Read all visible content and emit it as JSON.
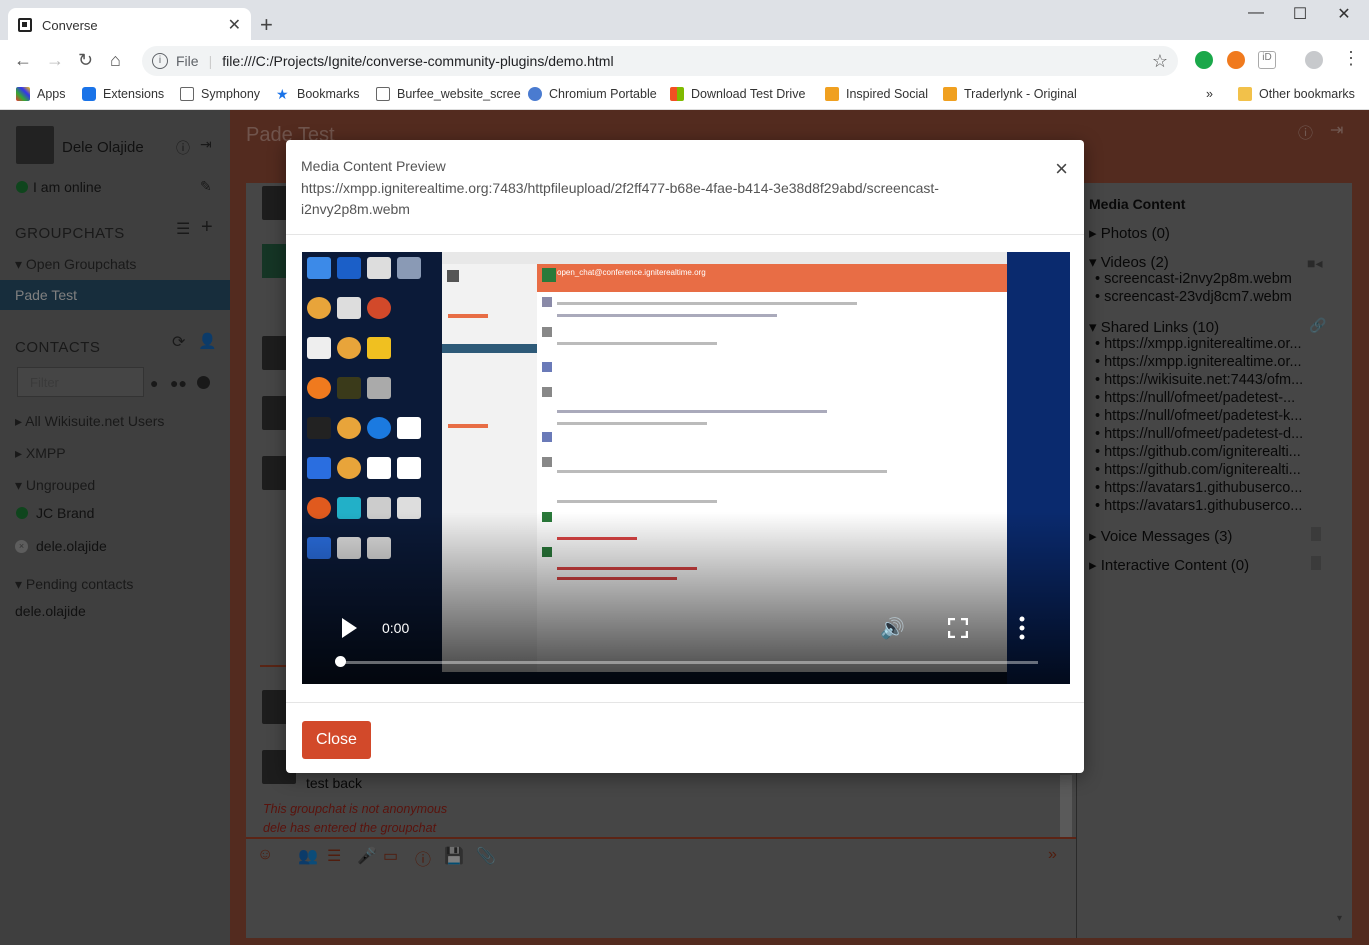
{
  "browser": {
    "tab_title": "Converse",
    "url_scheme_label": "File",
    "url": "file:///C:/Projects/Ignite/converse-community-plugins/demo.html",
    "bookmarks": [
      "Apps",
      "Extensions",
      "Symphony",
      "Bookmarks",
      "Burfee_website_scree",
      "Chromium Portable",
      "Download Test Drive",
      "Inspired Social",
      "Traderlynk - Original"
    ],
    "other_bookmarks": "Other bookmarks",
    "overflow": "»"
  },
  "sidebar": {
    "user_name": "Dele Olajide",
    "status": "I am online",
    "groupchats_heading": "GROUPCHATS",
    "open_groupchats": "Open Groupchats",
    "active_room": "Pade Test",
    "contacts_heading": "CONTACTS",
    "filter_placeholder": "Filter",
    "groups": [
      "All Wikisuite.net Users",
      "XMPP"
    ],
    "ungrouped": "Ungrouped",
    "contacts": [
      "JC Brand",
      "dele.olajide"
    ],
    "pending_heading": "Pending contacts",
    "pending": [
      "dele.olajide"
    ]
  },
  "room": {
    "title": "Pade Test",
    "last_message": "test back",
    "notices": [
      "This groupchat is not anonymous",
      "dele has entered the groupchat"
    ]
  },
  "media_panel": {
    "title": "Media Content",
    "photos": "Photos (0)",
    "videos": "Videos (2)",
    "video_items": [
      "screencast-i2nvy2p8m.webm",
      "screencast-23vdj8cm7.webm"
    ],
    "links": "Shared Links (10)",
    "link_items": [
      "https://xmpp.igniterealtime.or...",
      "https://xmpp.igniterealtime.or...",
      "https://wikisuite.net:7443/ofm...",
      "https://null/ofmeet/padetest-...",
      "https://null/ofmeet/padetest-k...",
      "https://null/ofmeet/padetest-d...",
      "https://github.com/igniterealti...",
      "https://github.com/igniterealti...",
      "https://avatars1.githubuserco...",
      "https://avatars1.githubuserco..."
    ],
    "voice": "Voice Messages (3)",
    "interactive": "Interactive Content (0)"
  },
  "modal": {
    "title": "Media Content Preview",
    "url": "https://xmpp.igniterealtime.org:7483/httpfileupload/2f2ff477-b68e-4fae-b414-3e38d8f29abd/screencast-i2nvy2p8m.webm",
    "close_label": "Close",
    "time": "0:00",
    "progress": 0,
    "inner_room": "open_chat@conference.igniterealtime.org"
  },
  "colors": {
    "accent": "#d2492a",
    "main_bg": "#a6573f",
    "sidebar_bg": "#7f7f7f",
    "online": "#1f8a3a"
  }
}
